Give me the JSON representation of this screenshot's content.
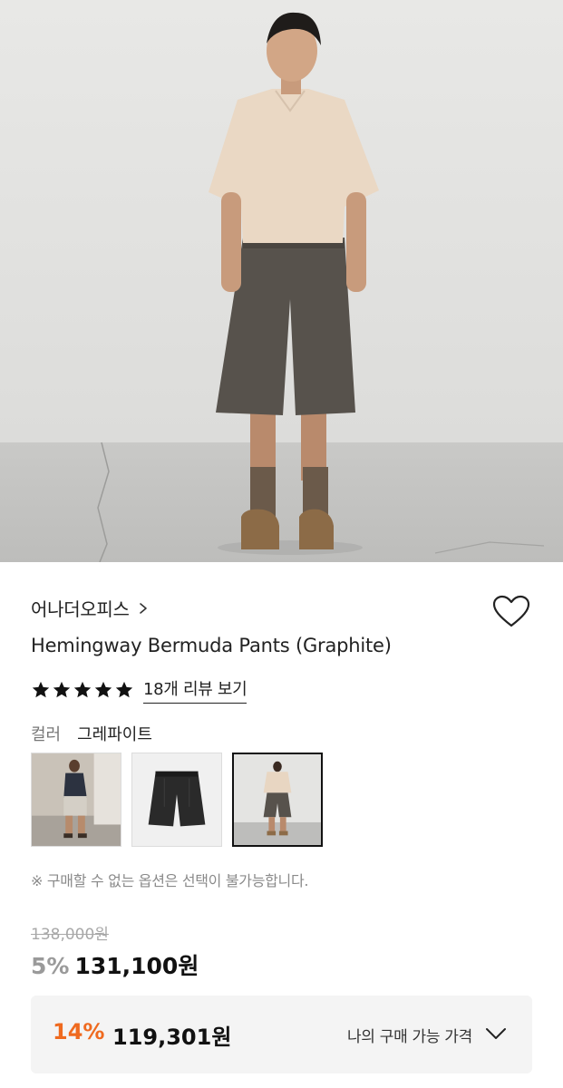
{
  "product": {
    "brand": "어나더오피스",
    "title": "Hemingway Bermuda Pants (Graphite)",
    "rating_stars": 5,
    "review_link": "18개 리뷰 보기",
    "color_label": "컬러",
    "color_value": "그레파이트",
    "notice": "※ 구매할 수 없는 옵션은 선택이 불가능합니다."
  },
  "pricing": {
    "original_price": "138,000원",
    "discount": "5%",
    "price": "131,100원",
    "best_discount": "14%",
    "best_price": "119,301원",
    "best_label": "나의 구매 가능 가격"
  },
  "icons": {
    "brand_chevron": "chevron-right-icon",
    "heart": "heart-outline-icon",
    "star": "star-filled-icon",
    "expand": "chevron-down-icon"
  },
  "colors": {
    "accent_orange": "#ef6a1f",
    "text_primary": "#111111",
    "text_muted": "#9a9a9a"
  }
}
